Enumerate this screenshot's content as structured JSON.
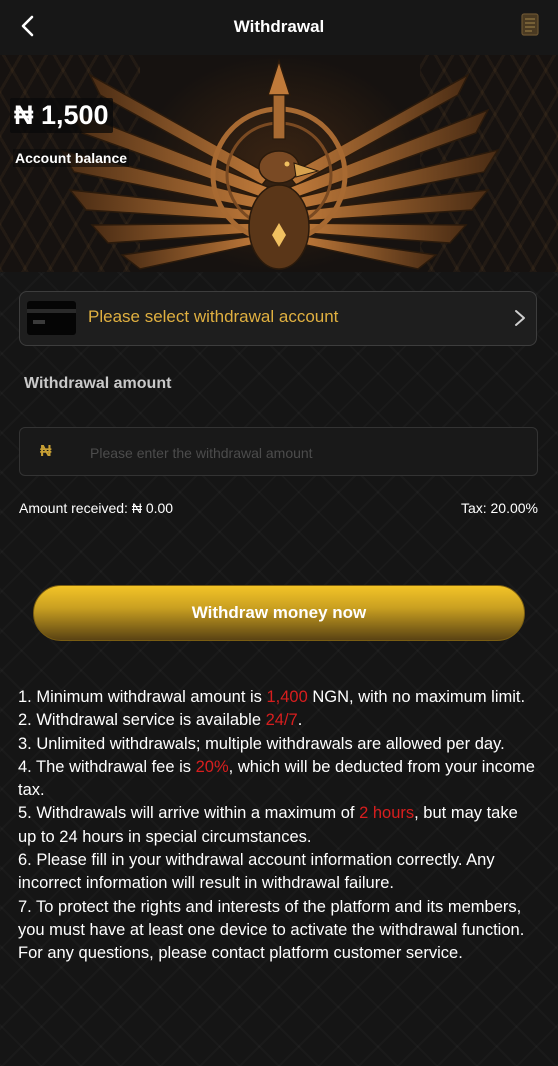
{
  "header": {
    "title": "Withdrawal"
  },
  "balance": {
    "amount": "₦ 1,500",
    "label": "Account balance"
  },
  "account": {
    "placeholder": "Please select withdrawal account"
  },
  "amount_section": {
    "label": "Withdrawal amount",
    "currency_symbol": "₦",
    "placeholder": "Please enter the withdrawal amount",
    "value": ""
  },
  "summary": {
    "received": "Amount received: ₦ 0.00",
    "tax": "Tax: 20.00%"
  },
  "submit": {
    "label": "Withdraw money now"
  },
  "rules": {
    "r1_a": "1. Minimum withdrawal amount is ",
    "r1_hl": "1,400",
    "r1_b": " NGN, with no maximum limit.",
    "r2_a": "2. Withdrawal service is available ",
    "r2_hl": "24/7",
    "r2_b": ".",
    "r3": "3. Unlimited withdrawals; multiple withdrawals are allowed per day.",
    "r4_a": "4. The withdrawal fee is ",
    "r4_hl": "20%",
    "r4_b": ", which will be deducted from your income tax.",
    "r5_a": "5. Withdrawals will arrive within a maximum of ",
    "r5_hl": "2 hours",
    "r5_b": ", but may take up to 24 hours in special circumstances.",
    "r6": "6. Please fill in your withdrawal account information correctly. Any incorrect information will result in withdrawal failure.",
    "r7": "7. To protect the rights and interests of the platform and its members, you must have at least one device to activate the withdrawal function.",
    "r8": "For any questions, please contact platform customer service."
  },
  "colors": {
    "accent_gold": "#e0b040",
    "highlight_red": "#d81e1e",
    "button_gold": "#f3c427"
  }
}
